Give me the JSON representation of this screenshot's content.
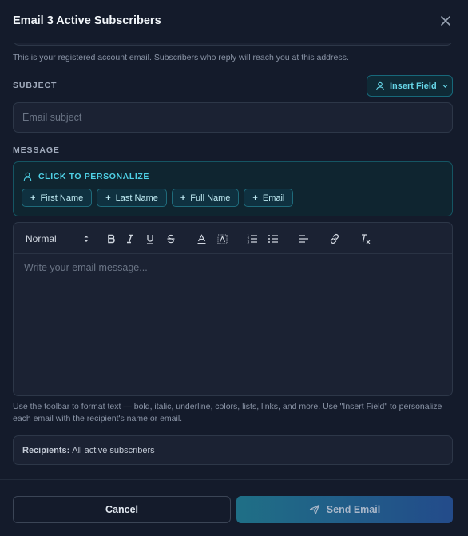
{
  "dialog": {
    "title": "Email 3 Active Subscribers"
  },
  "from_hint": "This is your registered account email. Subscribers who reply will reach you at this address.",
  "subject": {
    "label": "SUBJECT",
    "placeholder": "Email subject",
    "value": "",
    "insert_field_label": "Insert Field"
  },
  "message": {
    "label": "MESSAGE",
    "personalize_title": "CLICK TO PERSONALIZE",
    "chips": [
      "First Name",
      "Last Name",
      "Full Name",
      "Email"
    ],
    "chip_prefix": "+",
    "format_select": "Normal",
    "placeholder": "Write your email message..."
  },
  "toolbar_icons": [
    "bold-icon",
    "italic-icon",
    "underline-icon",
    "strikethrough-icon",
    "text-color-icon",
    "background-color-icon",
    "ordered-list-icon",
    "bullet-list-icon",
    "align-icon",
    "link-icon",
    "clear-format-icon"
  ],
  "help_text": "Use the toolbar to format text — bold, italic, underline, colors, lists, links, and more. Use \"Insert Field\" to personalize each email with the recipient's name or email.",
  "recipients": {
    "label": "Recipients:",
    "value": "All active subscribers"
  },
  "footer": {
    "cancel_label": "Cancel",
    "send_label": "Send Email"
  },
  "colors": {
    "accent": "#4fd1e6",
    "background": "#141b2b",
    "panel": "#1b2233"
  }
}
